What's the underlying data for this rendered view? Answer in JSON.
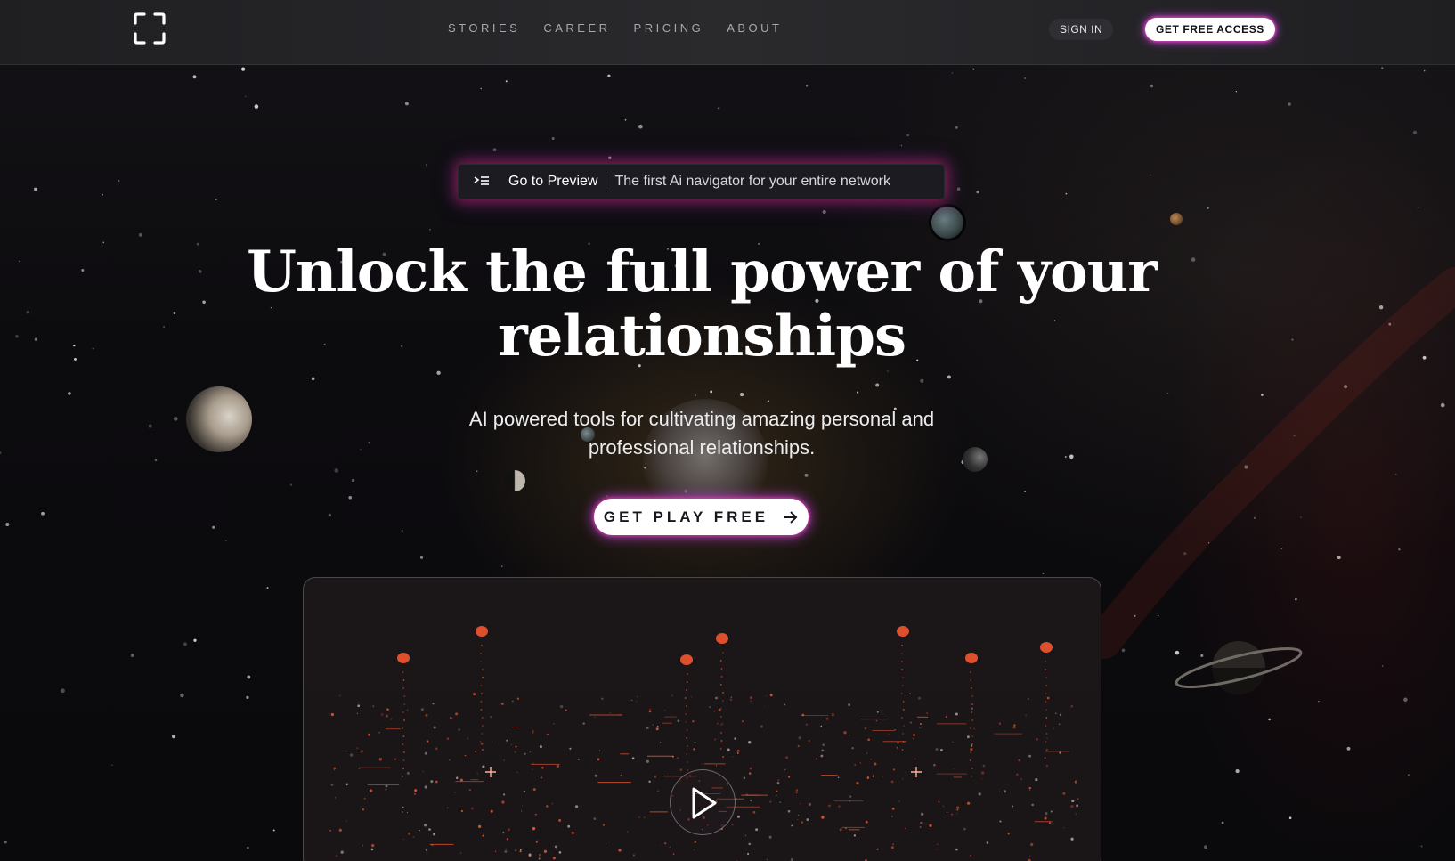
{
  "nav": {
    "links": [
      {
        "label": "STORIES"
      },
      {
        "label": "CAREER"
      },
      {
        "label": "PRICING"
      },
      {
        "label": "ABOUT"
      }
    ],
    "sign_in_label": "SIGN IN",
    "get_access_label": "GET FREE ACCESS"
  },
  "announcement": {
    "cta_label": "Go to Preview",
    "text": "The first Ai navigator for your entire network"
  },
  "hero": {
    "headline_line1": "Unlock the full power of your",
    "headline_line2": "relationships",
    "subtitle_line1": "AI powered tools for cultivating amazing personal and",
    "subtitle_line2": "professional relationships.",
    "cta_label": "GET PLAY FREE"
  },
  "colors": {
    "background": "#0b0a0d",
    "nav_background": "#2a2a2d",
    "glow_pink": "#e0449a",
    "glow_purple": "#8a3bd8",
    "accent_orange": "#ff5a32"
  },
  "icons": {
    "logo": "focus-frame-icon",
    "announcement": "menu-lines-icon",
    "cta": "arrow-right-icon",
    "video": "play-icon"
  }
}
